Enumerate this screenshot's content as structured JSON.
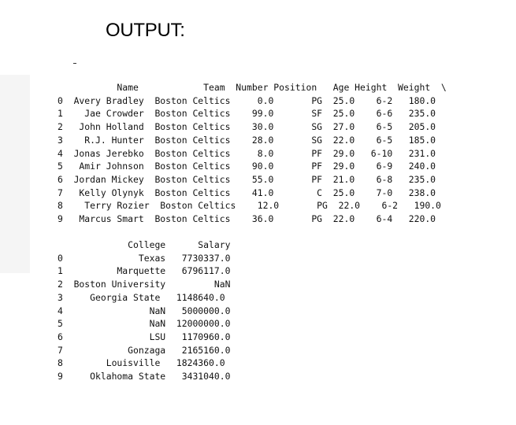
{
  "heading": "OUTPUT:",
  "table1_lines": [
    "           Name            Team  Number Position   Age Height  Weight  \\",
    "0  Avery Bradley  Boston Celtics     0.0       PG  25.0    6-2   180.0",
    "1    Jae Crowder  Boston Celtics    99.0       SF  25.0    6-6   235.0",
    "2   John Holland  Boston Celtics    30.0       SG  27.0    6-5   205.0",
    "3    R.J. Hunter  Boston Celtics    28.0       SG  22.0    6-5   185.0",
    "4  Jonas Jerebko  Boston Celtics     8.0       PF  29.0   6-10   231.0",
    "5   Amir Johnson  Boston Celtics    90.0       PF  29.0    6-9   240.0",
    "6  Jordan Mickey  Boston Celtics    55.0       PF  21.0    6-8   235.0",
    "7   Kelly Olynyk  Boston Celtics    41.0        C  25.0    7-0   238.0",
    "8    Terry Rozier  Boston Celtics    12.0       PG  22.0    6-2   190.0",
    "9   Marcus Smart  Boston Celtics    36.0       PG  22.0    6-4   220.0"
  ],
  "table2_lines": [
    "             College      Salary",
    "0              Texas   7730337.0",
    "1          Marquette   6796117.0",
    "2  Boston University         NaN",
    "3     Georgia State   1148640.0",
    "4                NaN   5000000.0",
    "5                NaN  12000000.0",
    "6                LSU   1170960.0",
    "7            Gonzaga   2165160.0",
    "8        Louisville   1824360.0",
    "9     Oklahoma State   3431040.0"
  ]
}
